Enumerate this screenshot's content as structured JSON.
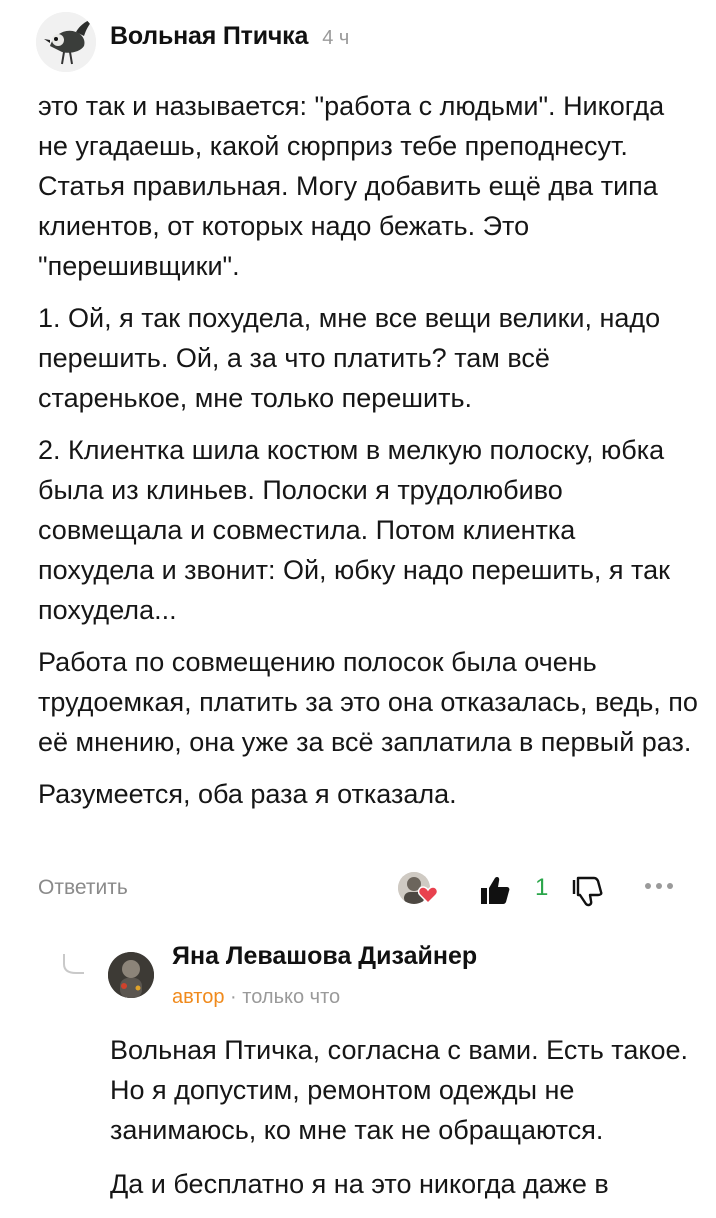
{
  "comment": {
    "author": "Вольная Птичка",
    "time": "4 ч",
    "paragraphs": [
      "это так и называется: \"работа с людьми\". Никогда не угадаешь, какой сюрприз тебе преподнесут. Статья правильная. Могу добавить ещё два типа клиентов, от которых надо бежать. Это \"перешивщики\".",
      "1. Ой, я так похудела, мне все вещи велики, надо перешить. Ой, а за что платить? там всё старенькое, мне только перешить.",
      "2. Клиентка шила костюм в мелкую полоску, юбка была из клиньев. Полоски я трудолюбиво совмещала и совместила. Потом клиентка похудела и звонит: Ой, юбку надо перешить, я так похудела...",
      "Работа по совмещению полосок была очень трудоемкая, платить за это она отказалась, ведь, по её мнению, она уже за всё заплатила в первый раз.",
      "Разумеется, оба раза я отказала."
    ],
    "reply_label": "Ответить",
    "like_count": "1"
  },
  "reply": {
    "author": "Яна Левашова Дизайнер",
    "tag": "автор",
    "separator": " · ",
    "time": "только что",
    "paragraphs": [
      "Вольная Птичка, согласна с вами. Есть такое. Но я допустим, ремонтом одежды не занимаюсь, ко мне так не обращаются.",
      "Да и бесплатно я на это никогда даже в"
    ]
  },
  "colors": {
    "like_count": "#2aa64a",
    "author_tag": "#f08a1c",
    "muted": "#9a9a9a"
  },
  "icons": [
    "bird-avatar",
    "liker-avatar",
    "heart-icon",
    "thumbs-up-icon",
    "thumbs-down-icon",
    "more-icon",
    "thread-line-icon"
  ]
}
